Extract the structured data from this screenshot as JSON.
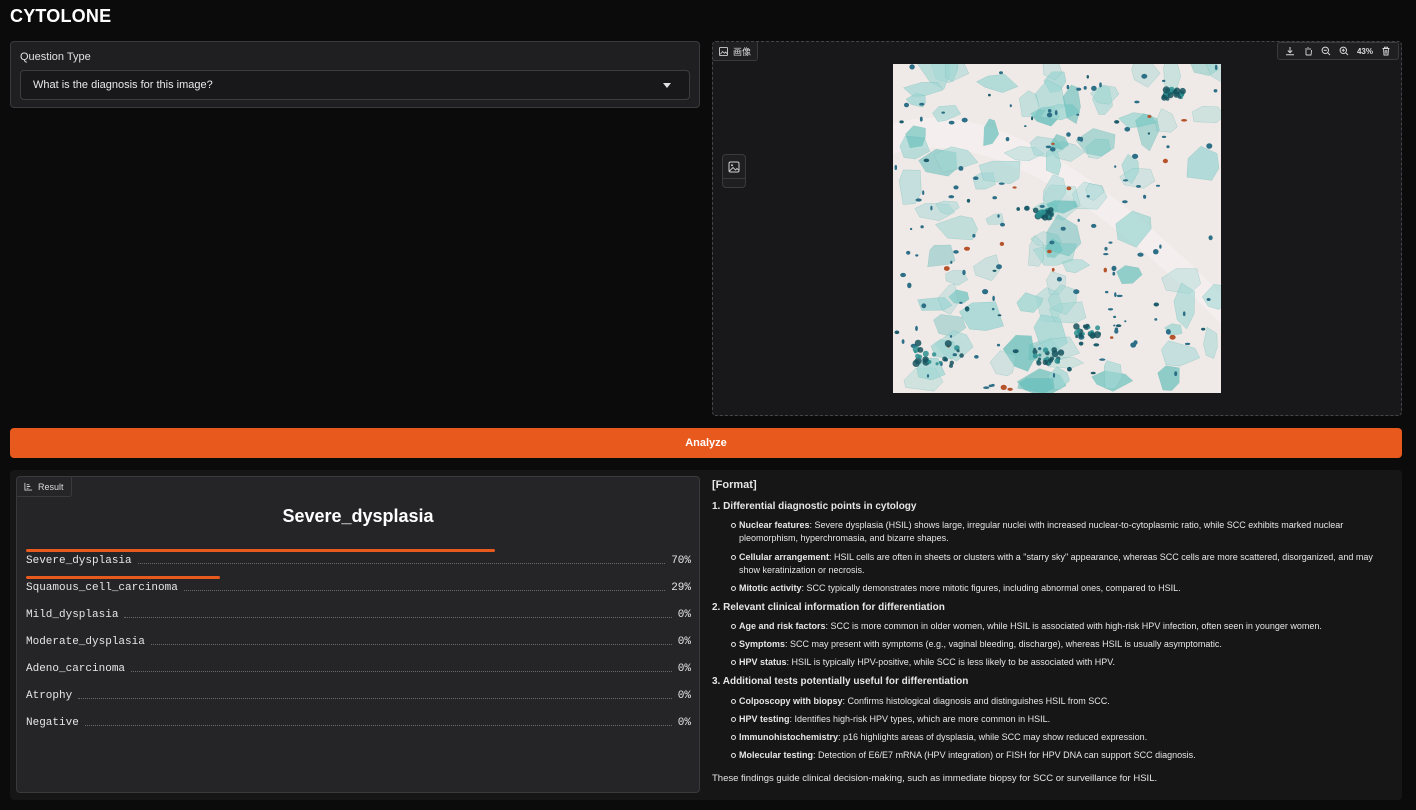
{
  "app": {
    "title": "CYTOLONE"
  },
  "question": {
    "label": "Question Type",
    "selected": "What is the diagnosis for this image?"
  },
  "image_panel": {
    "tag": "画像",
    "zoom": "43%",
    "icons": [
      "download-icon",
      "pan-icon",
      "zoom-out-icon",
      "zoom-in-icon",
      "delete-icon"
    ]
  },
  "analyze": {
    "label": "Analyze"
  },
  "result": {
    "tag": "Result",
    "top_label": "Severe_dysplasia",
    "confidences": [
      {
        "label": "Severe_dysplasia",
        "value": "70%",
        "fraction": 0.7
      },
      {
        "label": "Squamous_cell_carcinoma",
        "value": "29%",
        "fraction": 0.29
      },
      {
        "label": "Mild_dysplasia",
        "value": "0%",
        "fraction": 0
      },
      {
        "label": "Moderate_dysplasia",
        "value": "0%",
        "fraction": 0
      },
      {
        "label": "Adeno_carcinoma",
        "value": "0%",
        "fraction": 0
      },
      {
        "label": "Atrophy",
        "value": "0%",
        "fraction": 0
      },
      {
        "label": "Negative",
        "value": "0%",
        "fraction": 0
      }
    ]
  },
  "format": {
    "title": "[Format]",
    "sections": [
      {
        "heading": "1. Differential diagnostic points in cytology",
        "items": [
          {
            "term": "Nuclear features",
            "text": ": Severe dysplasia (HSIL) shows large, irregular nuclei with increased nuclear-to-cytoplasmic ratio, while SCC exhibits marked nuclear pleomorphism, hyperchromasia, and bizarre shapes."
          },
          {
            "term": "Cellular arrangement",
            "text": ": HSIL cells are often in sheets or clusters with a \"starry sky\" appearance, whereas SCC cells are more scattered, disorganized, and may show keratinization or necrosis."
          },
          {
            "term": "Mitotic activity",
            "text": ": SCC typically demonstrates more mitotic figures, including abnormal ones, compared to HSIL."
          }
        ]
      },
      {
        "heading": "2. Relevant clinical information for differentiation",
        "items": [
          {
            "term": "Age and risk factors",
            "text": ": SCC is more common in older women, while HSIL is associated with high-risk HPV infection, often seen in younger women."
          },
          {
            "term": "Symptoms",
            "text": ": SCC may present with symptoms (e.g., vaginal bleeding, discharge), whereas HSIL is usually asymptomatic."
          },
          {
            "term": "HPV status",
            "text": ": HSIL is typically HPV-positive, while SCC is less likely to be associated with HPV."
          }
        ]
      },
      {
        "heading": "3. Additional tests potentially useful for differentiation",
        "items": [
          {
            "term": "Colposcopy with biopsy",
            "text": ": Confirms histological diagnosis and distinguishes HSIL from SCC."
          },
          {
            "term": "HPV testing",
            "text": ": Identifies high-risk HPV types, which are more common in HSIL."
          },
          {
            "term": "Immunohistochemistry",
            "text": ": p16 highlights areas of dysplasia, while SCC may show reduced expression."
          },
          {
            "term": "Molecular testing",
            "text": ": Detection of E6/E7 mRNA (HPV integration) or FISH for HPV DNA can support SCC diagnosis."
          }
        ]
      }
    ],
    "footer": "These findings guide clinical decision-making, such as immediate biopsy for SCC or surveillance for HSIL."
  },
  "colors": {
    "accent": "#e8591d",
    "background": "#0b0b0c",
    "panel": "#1f1f21"
  }
}
